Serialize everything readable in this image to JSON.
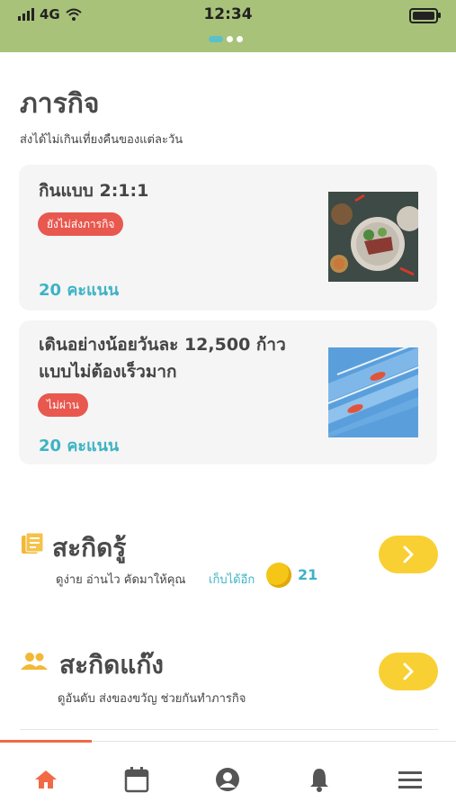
{
  "status_bar": {
    "signal": "4G",
    "time": "12:34"
  },
  "page": {
    "title": "ภารกิจ",
    "subtitle": "ส่งได้ไม่เกินเที่ยงคืนของแต่ละวัน"
  },
  "missions": [
    {
      "title": "กินแบบ 2:1:1",
      "status": "ยังไม่ส่งภารกิจ",
      "points": "20 คะแนน"
    },
    {
      "title_line1": "เดินอย่างน้อยวันละ 12,500 ก้าว",
      "title_line2": "แบบไม่ต้องเร็วมาก",
      "status": "ไม่ผ่าน",
      "points": "20 คะแนน"
    }
  ],
  "sections": {
    "knowledge": {
      "title": "สะกิดรู้",
      "subtitle": "ดูง่าย อ่านไว คัดมาให้คุณ",
      "extra": "เก็บได้อีก",
      "coins": "21"
    },
    "gang": {
      "title": "สะกิดแก๊ง",
      "subtitle": "ดูอันดับ ส่งของขวัญ ช่วยกันทำภารกิจ"
    }
  },
  "icons": {
    "tabs": [
      "home-icon",
      "calendar-icon",
      "profile-icon",
      "bell-icon",
      "menu-icon"
    ]
  },
  "colors": {
    "status_bar": "#a9c27a",
    "accent_teal": "#3db3c4",
    "badge_red": "#e8584f",
    "button_yellow": "#f9d033",
    "tab_active": "#f06a45"
  }
}
